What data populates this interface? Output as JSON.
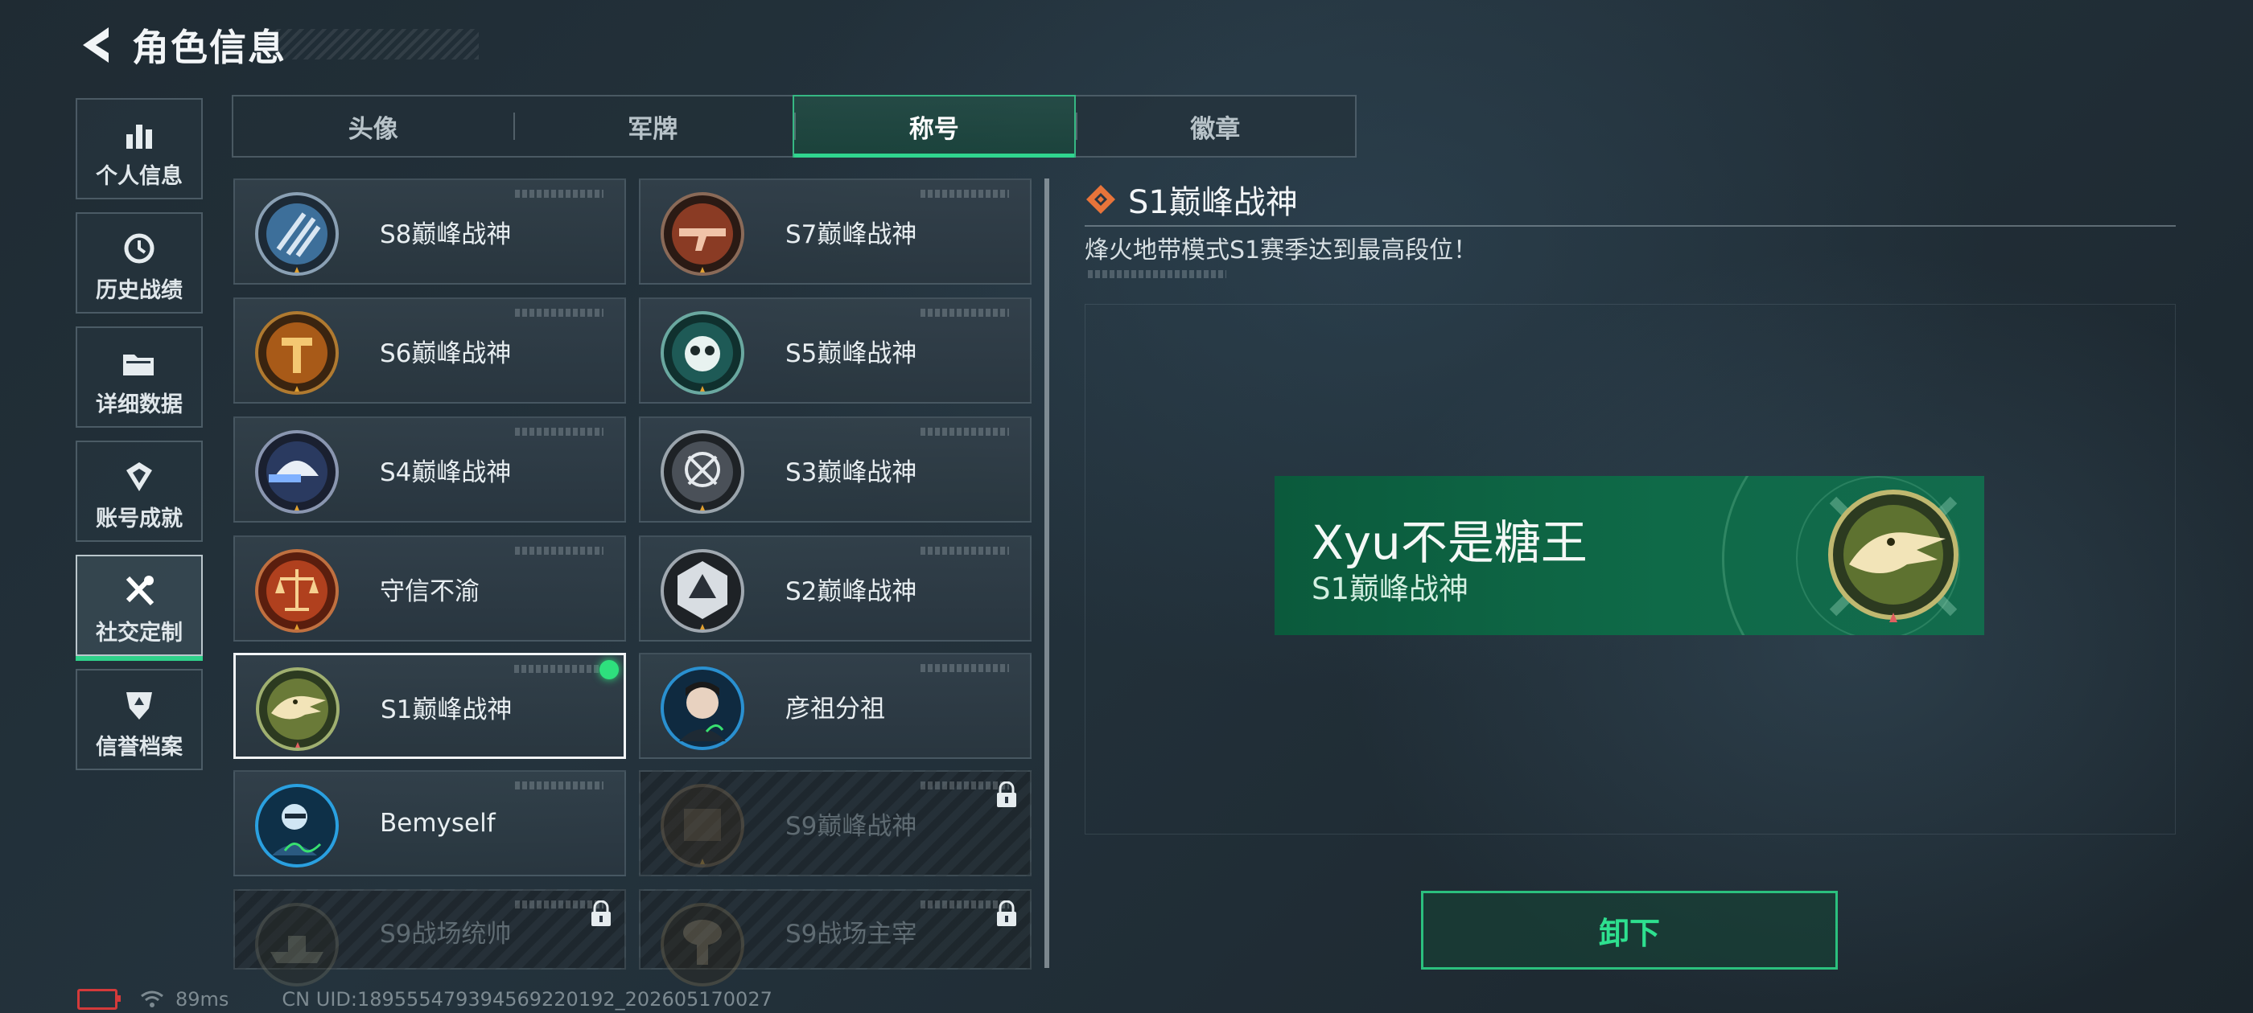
{
  "header": {
    "title": "角色信息",
    "back_icon": "back-arrow-icon"
  },
  "sidebar": {
    "items": [
      {
        "label": "个人信息",
        "icon": "bar-chart-icon",
        "active": false
      },
      {
        "label": "历史战绩",
        "icon": "history-clock-icon",
        "active": false
      },
      {
        "label": "详细数据",
        "icon": "folder-icon",
        "active": false
      },
      {
        "label": "账号成就",
        "icon": "achievement-icon",
        "active": false
      },
      {
        "label": "社交定制",
        "icon": "tools-icon",
        "active": true
      },
      {
        "label": "信誉档案",
        "icon": "shield-icon",
        "active": false
      }
    ]
  },
  "tabs": [
    {
      "label": "头像",
      "active": false
    },
    {
      "label": "军牌",
      "active": false
    },
    {
      "label": "称号",
      "active": true
    },
    {
      "label": "徽章",
      "active": false
    }
  ],
  "titles": [
    {
      "name": "S8巅峰战神",
      "badge": "s8-badge-icon",
      "state": "normal"
    },
    {
      "name": "S7巅峰战神",
      "badge": "s7-badge-icon",
      "state": "normal"
    },
    {
      "name": "S6巅峰战神",
      "badge": "s6-badge-icon",
      "state": "normal"
    },
    {
      "name": "S5巅峰战神",
      "badge": "s5-badge-icon",
      "state": "normal"
    },
    {
      "name": "S4巅峰战神",
      "badge": "s4-badge-icon",
      "state": "normal"
    },
    {
      "name": "S3巅峰战神",
      "badge": "s3-badge-icon",
      "state": "normal"
    },
    {
      "name": "守信不渝",
      "badge": "scales-badge-icon",
      "state": "normal"
    },
    {
      "name": "S2巅峰战神",
      "badge": "s2-badge-icon",
      "state": "normal"
    },
    {
      "name": "S1巅峰战神",
      "badge": "crocodile-badge-icon",
      "state": "selected-equipped"
    },
    {
      "name": "彦祖分祖",
      "badge": "portrait-badge-icon",
      "state": "normal"
    },
    {
      "name": "Bemyself",
      "badge": "portrait-signature-badge-icon",
      "state": "normal"
    },
    {
      "name": "S9巅峰战神",
      "badge": "s9-badge-icon",
      "state": "locked"
    },
    {
      "name": "S9战场统帅",
      "badge": "ship-badge-icon",
      "state": "locked"
    },
    {
      "name": "S9战场主宰",
      "badge": "mushroom-cloud-badge-icon",
      "state": "locked"
    }
  ],
  "detail": {
    "title": "S1巅峰战神",
    "title_icon": "diamond-icon",
    "description": "烽火地带模式S1赛季达到最高段位！"
  },
  "nameplate": {
    "player_name": "Xyu不是糖王",
    "title": "S1巅峰战神",
    "badge": "crocodile-badge-icon"
  },
  "actions": {
    "unequip_label": "卸下"
  },
  "footer": {
    "ping": "89ms",
    "uid": "CN UID:1895554793945692201​92_202605170027",
    "battery_icon": "battery-low-icon",
    "wifi_icon": "wifi-icon"
  },
  "colors": {
    "accent": "#2ee08f",
    "nameplate_bg": "#0f6a48",
    "selected_border": "#f2f5f7",
    "battery_low": "#d43a3a"
  }
}
